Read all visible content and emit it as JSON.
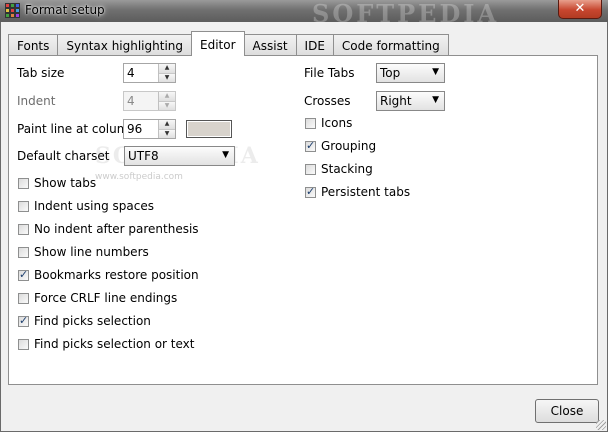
{
  "window": {
    "title": "Format setup",
    "close_glyph": "✕",
    "watermark": "SOFTPEDIA",
    "watermark_url": "www.softpedia.com"
  },
  "tabs": [
    {
      "label": "Fonts",
      "active": false
    },
    {
      "label": "Syntax highlighting",
      "active": false
    },
    {
      "label": "Editor",
      "active": true
    },
    {
      "label": "Assist",
      "active": false
    },
    {
      "label": "IDE",
      "active": false
    },
    {
      "label": "Code formatting",
      "active": false
    }
  ],
  "left": {
    "tab_size": {
      "label": "Tab size",
      "value": "4"
    },
    "indent": {
      "label": "Indent",
      "value": "4"
    },
    "paint_line": {
      "label": "Paint line at column",
      "value": "96",
      "color": "#d8d3cc"
    },
    "charset": {
      "label": "Default charset",
      "value": "UTF8"
    },
    "checkboxes": [
      {
        "label": "Show tabs",
        "checked": false
      },
      {
        "label": "Indent using spaces",
        "checked": false
      },
      {
        "label": "No indent after parenthesis",
        "checked": false
      },
      {
        "label": "Show line numbers",
        "checked": false
      },
      {
        "label": "Bookmarks restore position",
        "checked": true
      },
      {
        "label": "Force CRLF line endings",
        "checked": false
      },
      {
        "label": "Find picks selection",
        "checked": true
      },
      {
        "label": "Find picks selection or text",
        "checked": false
      }
    ]
  },
  "right": {
    "file_tabs": {
      "label": "File Tabs",
      "value": "Top"
    },
    "crosses": {
      "label": "Crosses",
      "value": "Right"
    },
    "checkboxes": [
      {
        "label": "Icons",
        "checked": false
      },
      {
        "label": "Grouping",
        "checked": true
      },
      {
        "label": "Stacking",
        "checked": false
      },
      {
        "label": "Persistent tabs",
        "checked": true
      }
    ]
  },
  "footer": {
    "close_label": "Close"
  },
  "glyphs": {
    "check": "✓",
    "up": "▲",
    "down": "▼"
  }
}
